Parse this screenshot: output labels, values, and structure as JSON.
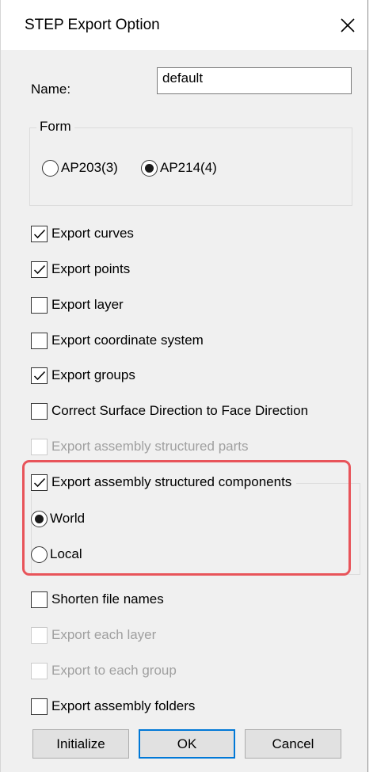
{
  "window": {
    "title": "STEP Export Option"
  },
  "name_field": {
    "label": "Name:",
    "value": "default"
  },
  "form_group": {
    "legend": "Form",
    "options": [
      {
        "label": "AP203(3)",
        "selected": false
      },
      {
        "label": "AP214(4)",
        "selected": true
      }
    ]
  },
  "options": [
    {
      "label": "Export curves",
      "checked": true,
      "enabled": true
    },
    {
      "label": "Export points",
      "checked": true,
      "enabled": true
    },
    {
      "label": "Export layer",
      "checked": false,
      "enabled": true
    },
    {
      "label": "Export coordinate system",
      "checked": false,
      "enabled": true
    },
    {
      "label": "Export groups",
      "checked": true,
      "enabled": true
    },
    {
      "label": "Correct Surface Direction to Face Direction",
      "checked": false,
      "enabled": true
    },
    {
      "label": "Export assembly structured parts",
      "checked": false,
      "enabled": false
    }
  ],
  "assembly_components": {
    "label": "Export assembly structured components",
    "checked": true,
    "modes": [
      {
        "label": "World",
        "selected": true
      },
      {
        "label": "Local",
        "selected": false
      }
    ]
  },
  "options_lower": [
    {
      "label": "Shorten file names",
      "checked": false,
      "enabled": true
    },
    {
      "label": "Export each layer",
      "checked": false,
      "enabled": false
    },
    {
      "label": "Export to each group",
      "checked": false,
      "enabled": false
    },
    {
      "label": "Export assembly folders",
      "checked": false,
      "enabled": true
    }
  ],
  "buttons": {
    "initialize": "Initialize",
    "ok": "OK",
    "cancel": "Cancel"
  },
  "colors": {
    "highlight": "#e8545a",
    "default_button_border": "#0078d7",
    "dialog_background": "#f0f0f0"
  },
  "icons": {
    "close": "close-icon",
    "check": "checkmark-icon"
  }
}
